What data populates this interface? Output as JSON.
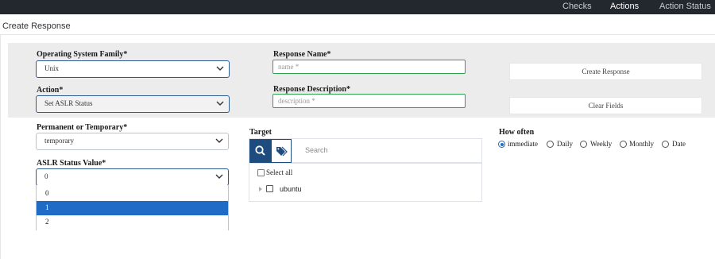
{
  "topnav": {
    "items": [
      "Checks",
      "Actions",
      "Action Status"
    ],
    "active": "Actions"
  },
  "page": {
    "title": "Create Response"
  },
  "form": {
    "os_family": {
      "label": "Operating System Family*",
      "value": "Unix"
    },
    "action": {
      "label": "Action*",
      "value": "Set ASLR Status"
    },
    "response_name": {
      "label": "Response Name*",
      "placeholder": "name *"
    },
    "response_description": {
      "label": "Response Description*",
      "placeholder": "description *"
    },
    "create_button": "Create Response",
    "clear_button": "Clear Fields",
    "permanent": {
      "label": "Permanent or Temporary*",
      "value": "temporary"
    },
    "aslr": {
      "label": "ASLR Status Value*",
      "value": "0",
      "options": [
        "0",
        "1",
        "2"
      ],
      "highlighted": "1"
    },
    "target": {
      "label": "Target",
      "search_placeholder": "Search",
      "select_all": "Select all",
      "items": [
        "ubuntu"
      ]
    },
    "how_often": {
      "label": "How often",
      "options": [
        "immediate",
        "Daily",
        "Weekly",
        "Monthly",
        "Date"
      ],
      "selected": "immediate"
    }
  },
  "colors": {
    "accent": "#1f4c7e",
    "selected": "#1f6bc6",
    "valid_border": "#2ea44f",
    "topbar": "#23272e"
  },
  "icons": [
    "chevron-down-icon",
    "search-icon",
    "tags-icon",
    "caret-right-icon"
  ]
}
